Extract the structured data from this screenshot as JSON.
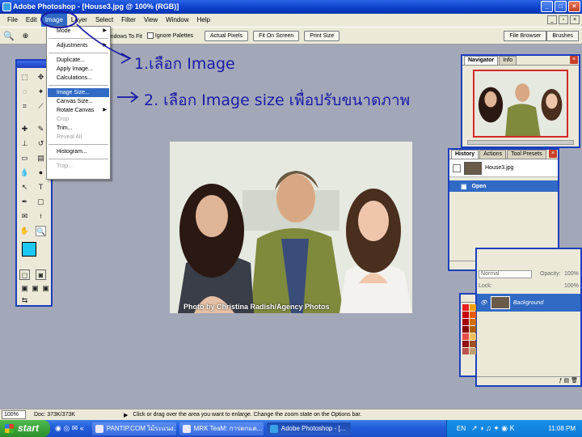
{
  "window": {
    "title": "Adobe Photoshop - [House3.jpg @ 100% (RGB)]"
  },
  "menubar": {
    "items": [
      "File",
      "Edit",
      "Image",
      "Layer",
      "Select",
      "Filter",
      "View",
      "Window",
      "Help"
    ],
    "active": "Image"
  },
  "options": {
    "checkbox_resize_label": "Resize Windows To Fit",
    "checkbox_ignore_label": "Ignore Palettes",
    "actual_pixels": "Actual Pixels",
    "fit_on_screen": "Fit On Screen",
    "print_size": "Print Size",
    "file_browser": "File Browser",
    "brushes": "Brushes"
  },
  "image_menu": {
    "mode": "Mode",
    "adjustments": "Adjustments",
    "duplicate": "Duplicate...",
    "apply_image": "Apply Image...",
    "calculations": "Calculations...",
    "image_size": "Image Size...",
    "canvas_size": "Canvas Size...",
    "rotate_canvas": "Rotate Canvas",
    "crop": "Crop",
    "trim": "Trim...",
    "reveal_all": "Reveal All",
    "histogram": "Histogram...",
    "trap": "Trap..."
  },
  "annotations": {
    "step1": "1.เลือก Image",
    "step2": "2. เลือก Image size เพื่อปรับขนาดภาพ"
  },
  "photo": {
    "caption": "Photo by Christina Radish/Agency Photos"
  },
  "navigator": {
    "tab_navigator": "Navigator",
    "tab_info": "Info"
  },
  "history": {
    "tab_history": "History",
    "tab_actions": "Actions",
    "tab_presets": "Tool Presets",
    "snapshot": "House3.jpg",
    "state_open": "Open"
  },
  "layers": {
    "blend_mode": "Normal",
    "opacity_label": "Opacity:",
    "opacity_value": "100%",
    "lock_label": "Lock:",
    "fill_value": "100%",
    "layer_name": "Background"
  },
  "status": {
    "zoom": "100%",
    "doc": "Doc: 373K/373K",
    "hint": "Click or drag over the area you want to enlarge. Change the zoom state on the Options bar."
  },
  "taskbar": {
    "start": "start",
    "tasks": [
      "PANTIP.COM ไม้ระแนง...",
      "MRK TeaM: การตกแต...",
      "Adobe Photoshop - [..."
    ],
    "language": "EN",
    "clock": "11:08 PM"
  },
  "colors": {
    "accent": "#1c3fbf",
    "annotation": "#1a1aa8",
    "foreground_swatch": "#1ec8f5",
    "selection": "#316ac5"
  }
}
